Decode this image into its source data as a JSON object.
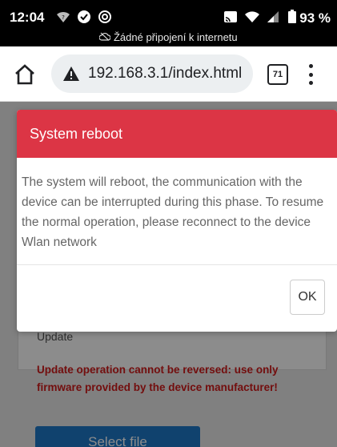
{
  "status_bar": {
    "time": "12:04",
    "battery_percent": "93 %",
    "offline_notice": "Žádné připojení k internetu"
  },
  "browser": {
    "url": "192.168.3.1/index.html",
    "tab_count": "71"
  },
  "page": {
    "update_label": "Update",
    "update_warning": "Update operation cannot be reversed: use only firmware provided by the device manufacturer!",
    "select_file_label": "Select file"
  },
  "modal": {
    "title": "System reboot",
    "message": "The system will reboot, the communication with the device can be interrupted during this phase. To resume the normal operation, please reconnect to the device Wlan network",
    "ok_label": "OK"
  },
  "colors": {
    "modal_header": "#dc3545",
    "warning_text": "#d11a1a",
    "primary_button": "#1e78c8"
  }
}
